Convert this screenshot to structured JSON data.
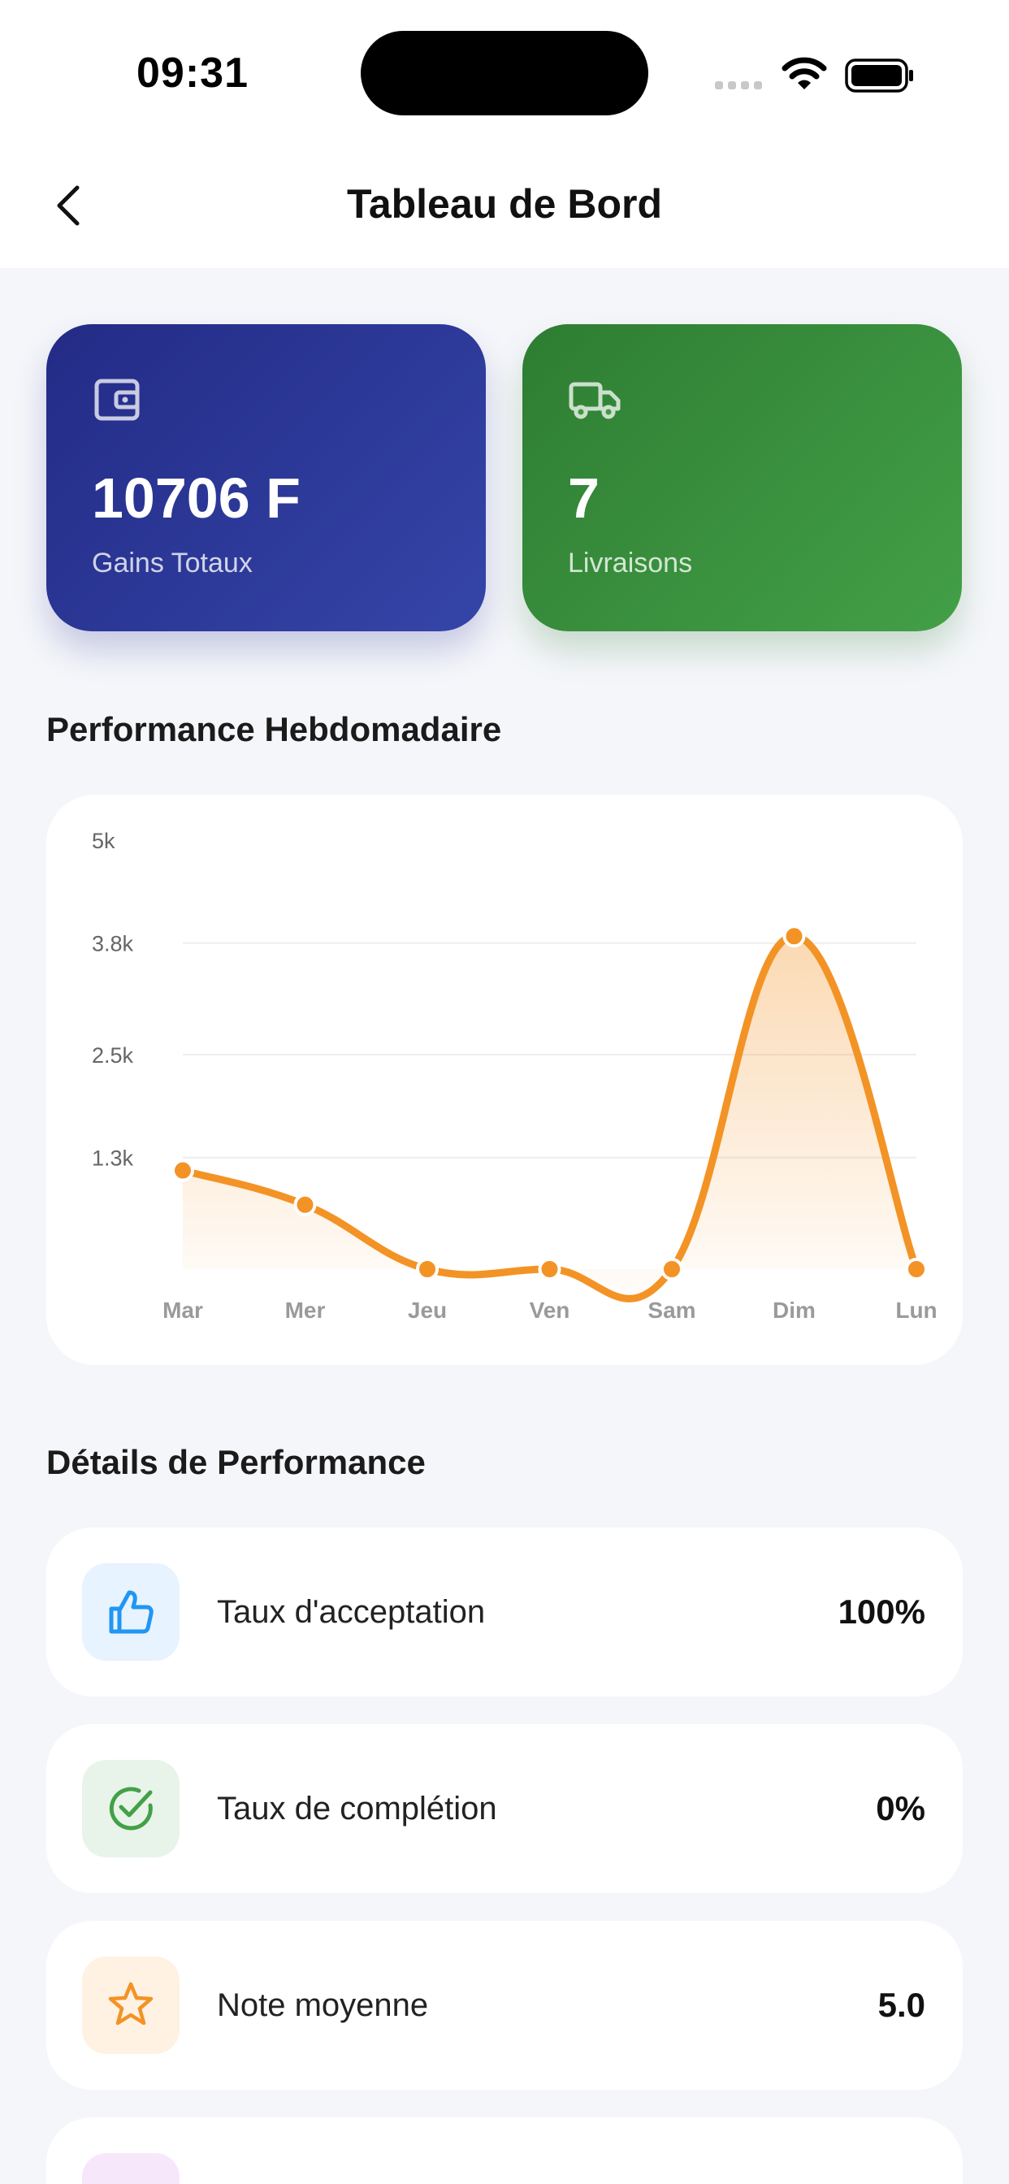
{
  "status_bar": {
    "time": "09:31"
  },
  "header": {
    "title": "Tableau de Bord",
    "back_icon": "chevron-left-icon"
  },
  "stats": [
    {
      "icon": "wallet-icon",
      "value": "10706 F",
      "label": "Gains Totaux",
      "color": "#283593"
    },
    {
      "icon": "truck-icon",
      "value": "7",
      "label": "Livraisons",
      "color": "#388e3c"
    }
  ],
  "weekly": {
    "title": "Performance Hebdomadaire",
    "chart_data": {
      "type": "area",
      "categories": [
        "Mar",
        "Mer",
        "Jeu",
        "Ven",
        "Sam",
        "Dim",
        "Lun"
      ],
      "values": [
        1150,
        750,
        0,
        0,
        0,
        3880,
        0
      ],
      "y_ticks": [
        "5k",
        "3.8k",
        "2.5k",
        "1.3k"
      ],
      "ylim": [
        0,
        5000
      ],
      "color": "#f39325",
      "grid": true
    }
  },
  "details": {
    "title": "Détails de Performance",
    "items": [
      {
        "icon": "thumbs-up-icon",
        "label": "Taux d'acceptation",
        "value": "100%",
        "icon_color": "#2196f3",
        "bg": "#e7f3fe"
      },
      {
        "icon": "check-circle-icon",
        "label": "Taux de complétion",
        "value": "0%",
        "icon_color": "#43a047",
        "bg": "#e8f4e9"
      },
      {
        "icon": "star-icon",
        "label": "Note moyenne",
        "value": "5.0",
        "icon_color": "#f39325",
        "bg": "#fff2e3"
      },
      {
        "icon": "purple-icon",
        "label": "",
        "value": "",
        "icon_color": "#9c27b0",
        "bg": "#f6e7fa"
      }
    ]
  }
}
